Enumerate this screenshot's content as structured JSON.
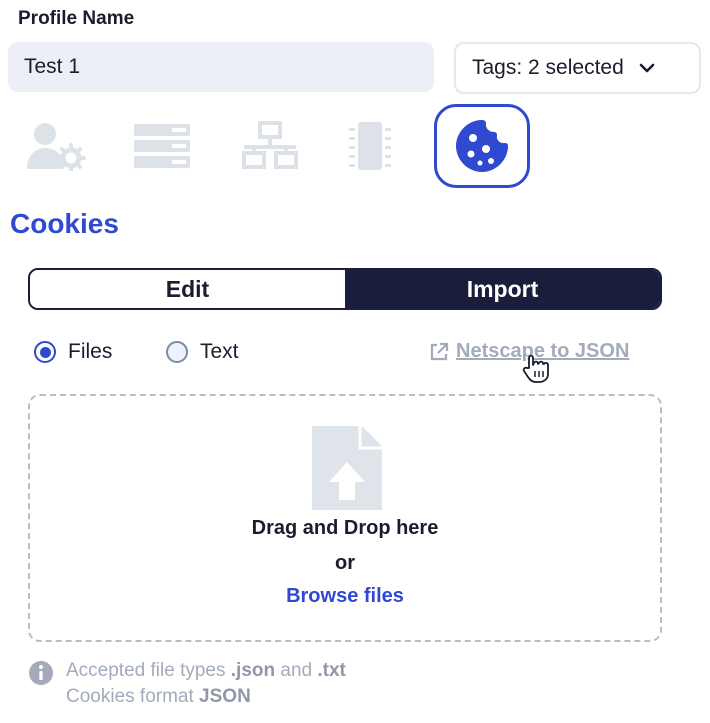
{
  "profile": {
    "label": "Profile Name",
    "name_value": "Test 1",
    "tags_label": "Tags: 2 selected"
  },
  "categories": [
    {
      "id": "user-settings",
      "icon": "user-gear-icon",
      "active": false
    },
    {
      "id": "storage",
      "icon": "server-icon",
      "active": false
    },
    {
      "id": "network",
      "icon": "network-icon",
      "active": false
    },
    {
      "id": "hardware",
      "icon": "chip-icon",
      "active": false
    },
    {
      "id": "cookies",
      "icon": "cookie-icon",
      "active": true
    }
  ],
  "section": {
    "title": "Cookies"
  },
  "mode_toggle": {
    "edit_label": "Edit",
    "import_label": "Import",
    "selected": "Import"
  },
  "source": {
    "files_label": "Files",
    "text_label": "Text",
    "selected": "Files"
  },
  "netscape_link": {
    "label": "Netscape to JSON"
  },
  "dropzone": {
    "title": "Drag and Drop here",
    "or_label": "or",
    "browse_label": "Browse files"
  },
  "note": {
    "prefix": "Accepted file types ",
    "ext1": ".json",
    "and": " and ",
    "ext2": ".txt",
    "format_prefix": "Cookies format ",
    "format_value": "JSON"
  },
  "colors": {
    "accent": "#2f49d1",
    "dark": "#1a1d3b",
    "muted": "#a3abbb",
    "inactive_icon": "#dde1e8"
  }
}
